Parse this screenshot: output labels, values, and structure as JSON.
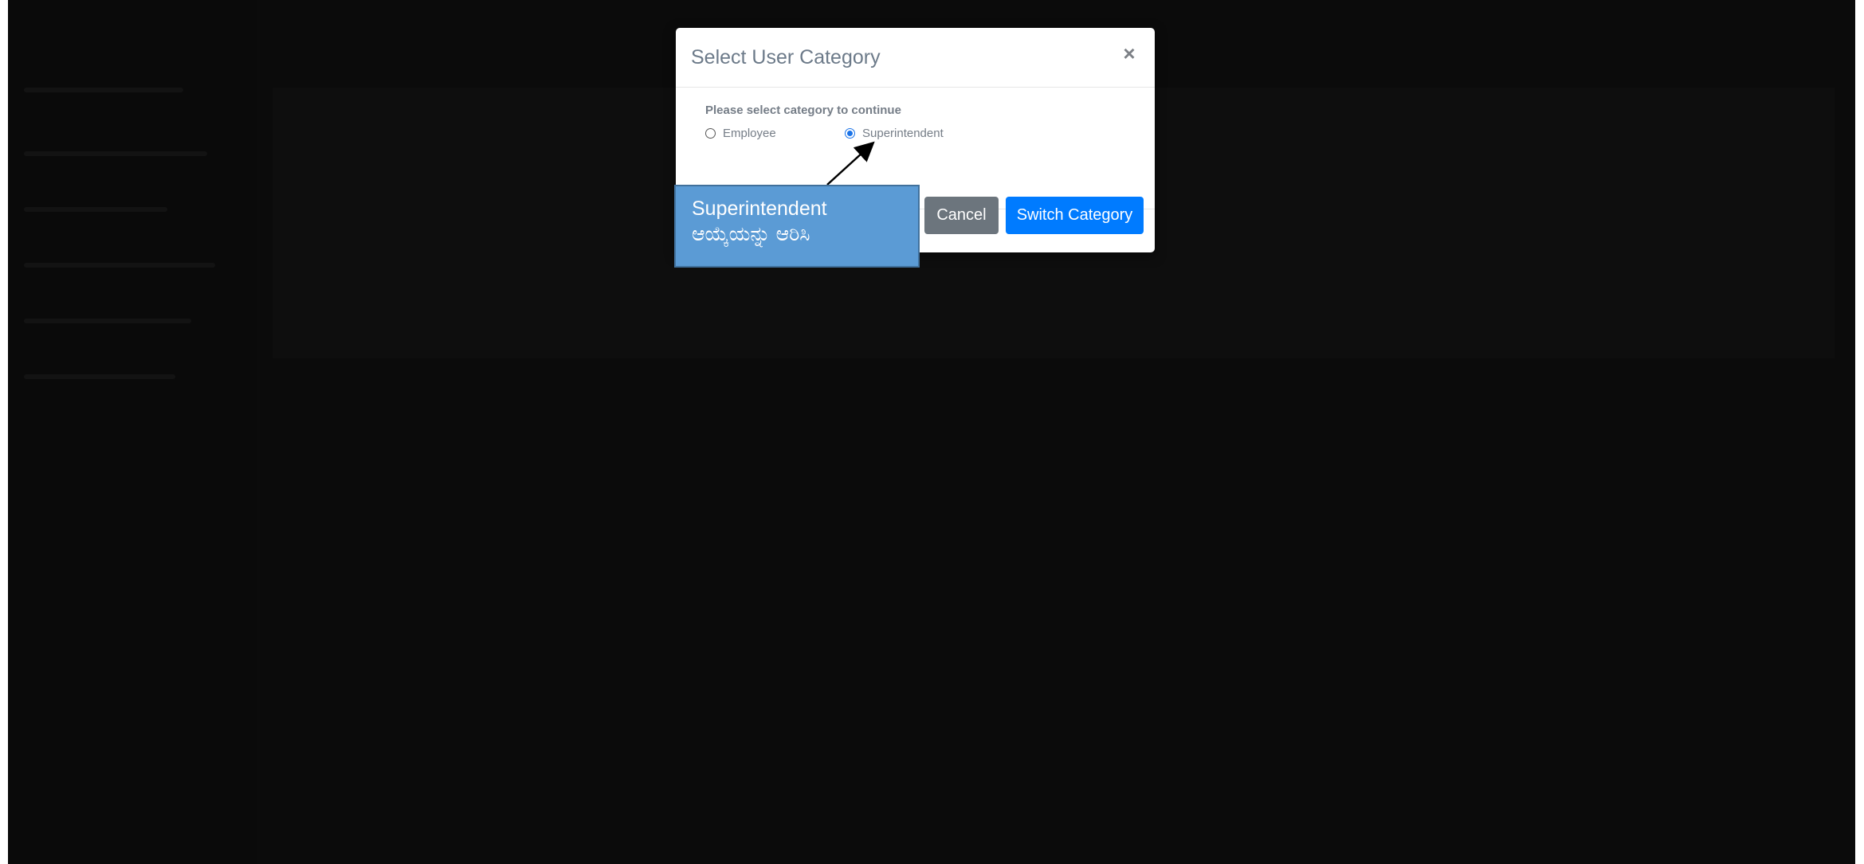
{
  "modal": {
    "title": "Select User Category",
    "close_glyph": "×",
    "prompt": "Please select category to continue",
    "options": [
      {
        "label": "Employee",
        "selected": false
      },
      {
        "label": "Superintendent",
        "selected": true
      }
    ],
    "cancel_label": "Cancel",
    "switch_label": "Switch Category"
  },
  "callout": {
    "line1": "Superintendent",
    "line2": "ಆಯ್ಕೆಯನ್ನು ಆರಿಸಿ"
  },
  "colors": {
    "overlay": "#070707",
    "primary": "#007bff",
    "secondary": "#6c757d",
    "callout_fill": "#5b9bd5",
    "callout_border": "#41719c"
  },
  "icons": {
    "close": "close-icon",
    "arrow": "arrow-icon"
  }
}
